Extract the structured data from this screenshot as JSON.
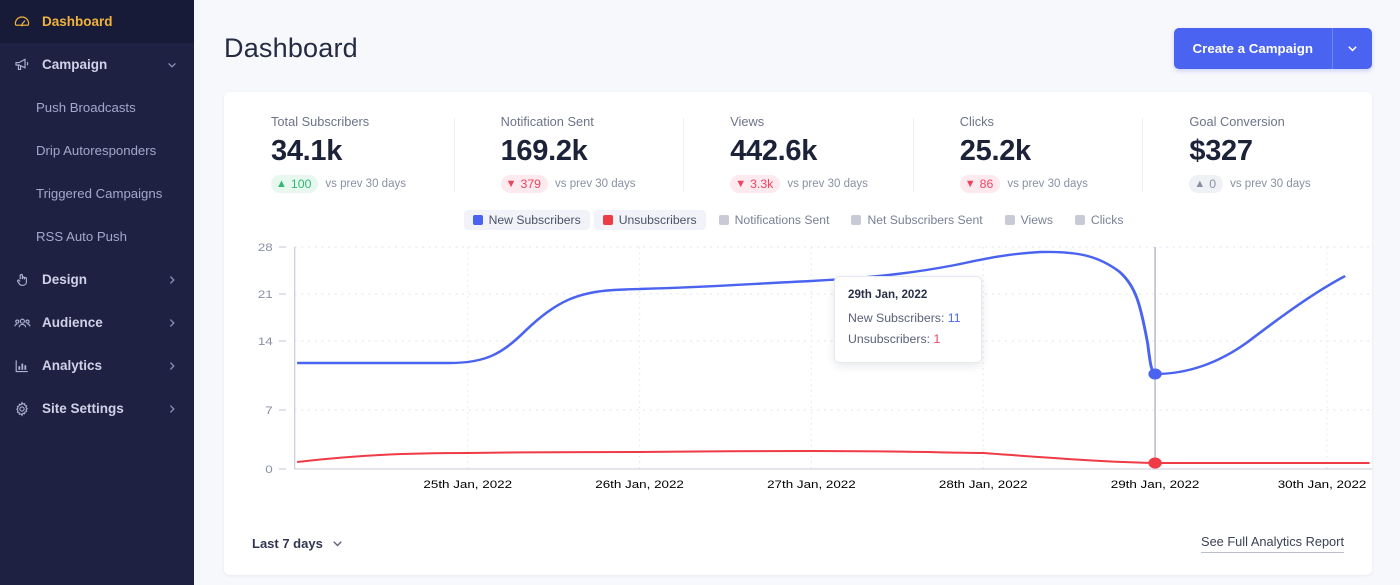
{
  "sidebar": {
    "items": [
      {
        "label": "Dashboard",
        "icon": "gauge-icon",
        "active": true,
        "caret": "none"
      },
      {
        "label": "Campaign",
        "icon": "megaphone-icon",
        "active": false,
        "caret": "down"
      },
      {
        "label": "Push Broadcasts",
        "icon": "none",
        "sub": true
      },
      {
        "label": "Drip Autoresponders",
        "icon": "none",
        "sub": true
      },
      {
        "label": "Triggered Campaigns",
        "icon": "none",
        "sub": true
      },
      {
        "label": "RSS Auto Push",
        "icon": "none",
        "sub": true
      },
      {
        "label": "Design",
        "icon": "hand-pointer-icon",
        "active": false,
        "caret": "right"
      },
      {
        "label": "Audience",
        "icon": "people-icon",
        "active": false,
        "caret": "right"
      },
      {
        "label": "Analytics",
        "icon": "bar-chart-icon",
        "active": false,
        "caret": "right"
      },
      {
        "label": "Site Settings",
        "icon": "gear-icon",
        "active": false,
        "caret": "right"
      }
    ],
    "bg_color": "#1e2142",
    "active_color": "#f2b33d"
  },
  "header": {
    "title": "Dashboard",
    "cta_label": "Create a Campaign",
    "cta_color": "#4a63f0"
  },
  "stats": [
    {
      "label": "Total Subscribers",
      "value": "34.1k",
      "delta": "100",
      "direction": "up",
      "note": "vs prev 30 days"
    },
    {
      "label": "Notification Sent",
      "value": "169.2k",
      "delta": "379",
      "direction": "down",
      "note": "vs prev 30 days"
    },
    {
      "label": "Views",
      "value": "442.6k",
      "delta": "3.3k",
      "direction": "down",
      "note": "vs prev 30 days"
    },
    {
      "label": "Clicks",
      "value": "25.2k",
      "delta": "86",
      "direction": "down",
      "note": "vs prev 30 days"
    },
    {
      "label": "Goal Conversion",
      "value": "$327",
      "delta": "0",
      "direction": "flat",
      "note": "vs prev 30 days"
    }
  ],
  "legend": [
    {
      "label": "New Subscribers",
      "color": "#4a63f0",
      "active": true
    },
    {
      "label": "Unsubscribers",
      "color": "#ef3b46",
      "active": true
    },
    {
      "label": "Notifications Sent",
      "color": "#c8cbd6",
      "active": false
    },
    {
      "label": "Net Subscribers Sent",
      "color": "#c8cbd6",
      "active": false
    },
    {
      "label": "Views",
      "color": "#c8cbd6",
      "active": false
    },
    {
      "label": "Clicks",
      "color": "#c8cbd6",
      "active": false
    }
  ],
  "tooltip": {
    "date": "29th Jan, 2022",
    "row1_label": "New Subscribers:",
    "row1_value": "11",
    "row2_label": "Unsubscribers:",
    "row2_value": "1"
  },
  "footer": {
    "range_label": "Last 7 days",
    "report_link": "See Full Analytics Report"
  },
  "chart_data": {
    "type": "line",
    "title": "",
    "xlabel": "",
    "ylabel": "",
    "grid": true,
    "legend_position": "top-center",
    "ylim": [
      0,
      28
    ],
    "yticks": [
      0,
      7,
      14,
      21,
      28
    ],
    "categories": [
      "25th Jan, 2022",
      "26th Jan, 2022",
      "27th Jan, 2022",
      "28th Jan, 2022",
      "29th Jan, 2022",
      "30th Jan, 2022"
    ],
    "series": [
      {
        "name": "New Subscribers",
        "color": "#4a63f0",
        "values": [
          13.3,
          22.5,
          23.0,
          26.6,
          11.0,
          24.0
        ]
      },
      {
        "name": "Unsubscribers",
        "color": "#ef3b46",
        "values": [
          1.5,
          1.6,
          1.6,
          1.5,
          1.0,
          1.0
        ]
      }
    ],
    "highlight": {
      "x": "29th Jan, 2022",
      "new_subscribers": 11,
      "unsubscribers": 1
    }
  }
}
